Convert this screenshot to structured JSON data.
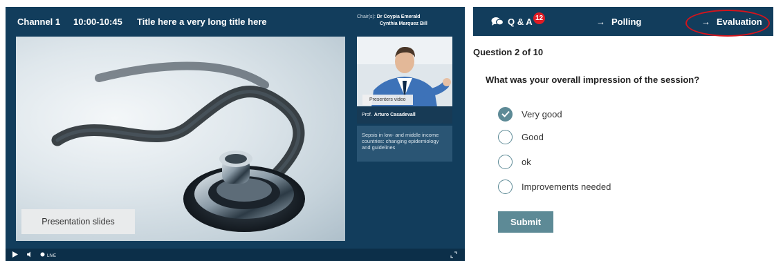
{
  "player": {
    "channel": "Channel 1",
    "time": "10:00-10:45",
    "title": "Title here a very long title here",
    "chairs_label": "Chair(s):",
    "chairs": [
      "Dr Coypia Emerald",
      "Cynthia Marquez Bill"
    ],
    "slides_label": "Presentation slides",
    "video_label": "Presenters video",
    "presenter_prefix": "Prof.",
    "presenter_name": "Arturo Casadevall",
    "talk_title": "Sepsis in low- and middle income countries: changing epidemiology and guidelines",
    "live_label": "LIVE"
  },
  "tabs": {
    "qa_label": "Q & A",
    "qa_badge": "12",
    "polling_label": "Polling",
    "evaluation_label": "Evaluation"
  },
  "survey": {
    "count": "Question 2 of 10",
    "question": "What was your overall impression of the session?",
    "options": [
      {
        "label": "Very good",
        "checked": true
      },
      {
        "label": "Good",
        "checked": false
      },
      {
        "label": "ok",
        "checked": false
      },
      {
        "label": "Improvements needed",
        "checked": false
      }
    ],
    "submit_label": "Submit"
  },
  "colors": {
    "panel": "#123d5c",
    "accent": "#5d8a96",
    "badge": "#e01b24",
    "highlight_ring": "#d4141c"
  },
  "icons": [
    "chat-bubbles-icon",
    "arrow-right-icon",
    "checkmark-icon",
    "play-icon",
    "volume-icon",
    "live-dot-icon",
    "fullscreen-icon"
  ]
}
